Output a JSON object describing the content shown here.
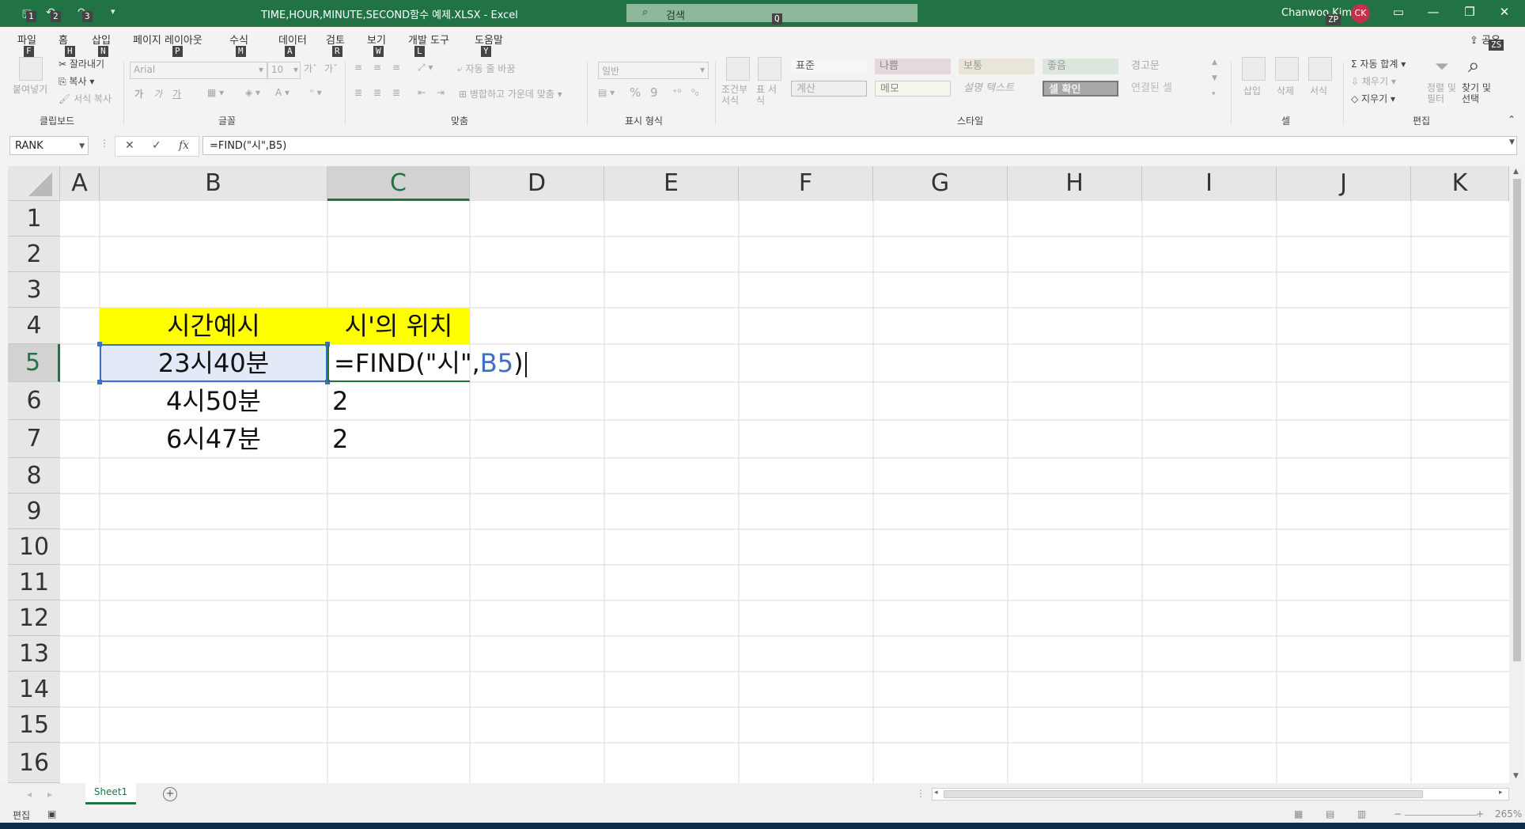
{
  "window": {
    "title": "TIME,HOUR,MINUTE,SECOND함수 예제.XLSX  -  Excel",
    "search_placeholder": "검색",
    "user": "Chanwoo Kim",
    "user_initials": "CK",
    "accent": "#217346",
    "keytips": {
      "qa1": "1",
      "qa2": "2",
      "qa3": "3",
      "search": "Q",
      "account": "ZP",
      "share": "ZS"
    }
  },
  "ribbon_tabs": [
    {
      "label": "파일",
      "keytip": "F"
    },
    {
      "label": "홈",
      "keytip": "H"
    },
    {
      "label": "삽입",
      "keytip": "N"
    },
    {
      "label": "페이지 레이아웃",
      "keytip": "P"
    },
    {
      "label": "수식",
      "keytip": "M"
    },
    {
      "label": "데이터",
      "keytip": "A"
    },
    {
      "label": "검토",
      "keytip": "R"
    },
    {
      "label": "보기",
      "keytip": "W"
    },
    {
      "label": "개발 도구",
      "keytip": "L"
    },
    {
      "label": "도움말",
      "keytip": "Y"
    }
  ],
  "share_label": "공유",
  "ribbon": {
    "clipboard": {
      "paste": "붙여넣기",
      "cut": "잘라내기",
      "copy": "복사",
      "format_painter": "서식 복사",
      "group": "클립보드"
    },
    "font": {
      "name": "Arial",
      "size": "10",
      "bold": "가",
      "italic": "가",
      "underline": "가",
      "group": "글꼴"
    },
    "alignment": {
      "wrap": "자동 줄 바꿈",
      "merge": "병합하고 가운데 맞춤",
      "group": "맞춤"
    },
    "number": {
      "format": "일반",
      "percent": "%",
      "comma": "9",
      "group": "표시 형식"
    },
    "styles": {
      "conditional": "조건부 서식",
      "table": "표 서식",
      "cells": [
        "표준",
        "나쁨",
        "보통",
        "좋음",
        "경고문",
        "계산",
        "메모",
        "설명 텍스트",
        "셀 확인",
        "연결된 셀"
      ],
      "group": "스타일"
    },
    "cells_group": {
      "insert": "삽입",
      "delete": "삭제",
      "format": "서식",
      "group": "셀"
    },
    "editing": {
      "autosum": "자동 합계",
      "fill": "채우기",
      "clear": "지우기",
      "sort": "정렬 및 필터",
      "find": "찾기 및 선택",
      "group": "편집"
    }
  },
  "formula_bar": {
    "name_box": "RANK",
    "formula": "=FIND(\"시\",B5)",
    "cancel": "✕",
    "enter": "✓",
    "fx": "fx"
  },
  "columns": [
    "A",
    "B",
    "C",
    "D",
    "E",
    "F",
    "G",
    "H",
    "I",
    "J",
    "K"
  ],
  "rows": [
    "1",
    "2",
    "3",
    "4",
    "5",
    "6",
    "7",
    "8",
    "9",
    "10",
    "11",
    "12",
    "13",
    "14",
    "15",
    "16"
  ],
  "cells": {
    "B4": "시간예시",
    "C4": "시'의 위치",
    "B5": "23시40분",
    "C5_prefix": "=FIND(\"시\",",
    "C5_ref": "B5",
    "C5_suffix": ")",
    "B6": "4시50분",
    "C6": "2",
    "B7": "6시47분",
    "C7": "2"
  },
  "colors": {
    "header_fill": "#ffff00",
    "selected_fill": "#e3eaf7",
    "ref_blue": "#3d6fc4"
  },
  "sheet": {
    "tab": "Sheet1",
    "add": "+"
  },
  "status": {
    "mode": "편집",
    "zoom": "265%"
  }
}
